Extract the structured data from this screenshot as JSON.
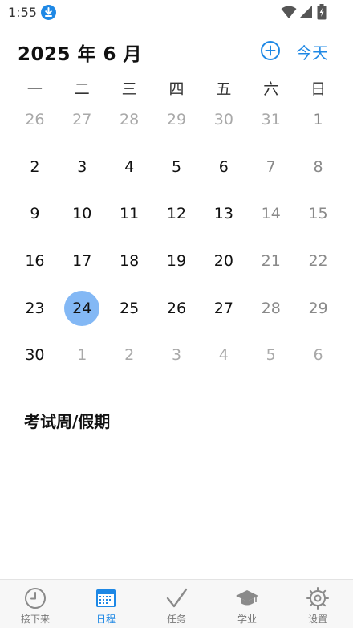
{
  "status_bar": {
    "time": "1:55"
  },
  "header": {
    "month_title": "2025 年 6 月",
    "today_label": "今天"
  },
  "weekdays": [
    "一",
    "二",
    "三",
    "四",
    "五",
    "六",
    "日"
  ],
  "calendar": {
    "days": [
      {
        "label": "26",
        "muted": true
      },
      {
        "label": "27",
        "muted": true
      },
      {
        "label": "28",
        "muted": true
      },
      {
        "label": "29",
        "muted": true
      },
      {
        "label": "30",
        "muted": true
      },
      {
        "label": "31",
        "muted": true
      },
      {
        "label": "1",
        "weekend": true
      },
      {
        "label": "2"
      },
      {
        "label": "3"
      },
      {
        "label": "4"
      },
      {
        "label": "5"
      },
      {
        "label": "6"
      },
      {
        "label": "7",
        "weekend": true
      },
      {
        "label": "8",
        "weekend": true
      },
      {
        "label": "9"
      },
      {
        "label": "10"
      },
      {
        "label": "11"
      },
      {
        "label": "12"
      },
      {
        "label": "13"
      },
      {
        "label": "14",
        "weekend": true
      },
      {
        "label": "15",
        "weekend": true
      },
      {
        "label": "16"
      },
      {
        "label": "17"
      },
      {
        "label": "18"
      },
      {
        "label": "19"
      },
      {
        "label": "20"
      },
      {
        "label": "21",
        "weekend": true
      },
      {
        "label": "22",
        "weekend": true
      },
      {
        "label": "23"
      },
      {
        "label": "24",
        "selected": true
      },
      {
        "label": "25"
      },
      {
        "label": "26"
      },
      {
        "label": "27"
      },
      {
        "label": "28",
        "weekend": true
      },
      {
        "label": "29",
        "weekend": true
      },
      {
        "label": "30"
      },
      {
        "label": "1",
        "muted": true
      },
      {
        "label": "2",
        "muted": true
      },
      {
        "label": "3",
        "muted": true
      },
      {
        "label": "4",
        "muted": true
      },
      {
        "label": "5",
        "muted": true
      },
      {
        "label": "6",
        "muted": true
      }
    ]
  },
  "section": {
    "title": "考试周/假期"
  },
  "bottom_nav": {
    "items": [
      {
        "label": "接下来",
        "icon": "clock-icon",
        "active": false
      },
      {
        "label": "日程",
        "icon": "calendar-icon",
        "active": true
      },
      {
        "label": "任务",
        "icon": "check-icon",
        "active": false
      },
      {
        "label": "学业",
        "icon": "graduation-cap-icon",
        "active": false
      },
      {
        "label": "设置",
        "icon": "gear-icon",
        "active": false
      }
    ]
  },
  "colors": {
    "accent": "#1e88e5",
    "selected_day": "#83b8f5",
    "muted_text": "#a9a9a9",
    "weekend_text": "#8a8a8a"
  }
}
